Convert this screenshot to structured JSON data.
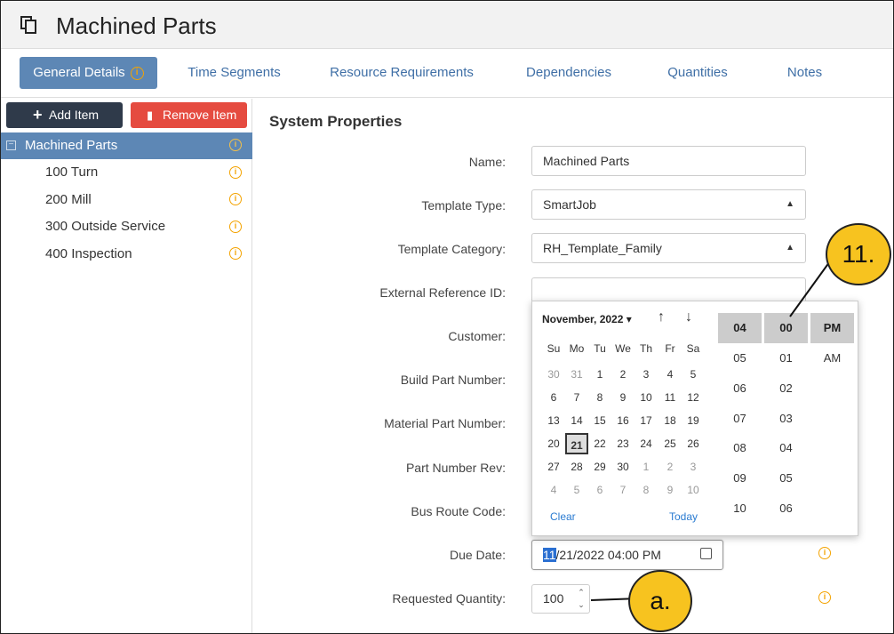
{
  "window": {
    "title": "Machined Parts"
  },
  "tabs": [
    {
      "label": "General Details"
    },
    {
      "label": "Time Segments"
    },
    {
      "label": "Resource Requirements"
    },
    {
      "label": "Dependencies"
    },
    {
      "label": "Quantities"
    },
    {
      "label": "Notes"
    }
  ],
  "toolbar": {
    "add_label": "Add Item",
    "remove_label": "Remove Item"
  },
  "tree": {
    "root": "Machined Parts",
    "items": [
      "100 Turn",
      "200 Mill",
      "300 Outside Service",
      "400 Inspection"
    ]
  },
  "form": {
    "section_title": "System Properties",
    "name_label": "Name:",
    "name_value": "Machined Parts",
    "template_type_label": "Template Type:",
    "template_type_value": "SmartJob",
    "template_category_label": "Template Category:",
    "template_category_value": "RH_Template_Family",
    "external_ref_label": "External Reference ID:",
    "customer_label": "Customer:",
    "build_part_label": "Build Part Number:",
    "material_part_label": "Material Part Number:",
    "part_rev_label": "Part Number Rev:",
    "bus_route_label": "Bus Route Code:",
    "due_date_label": "Due Date:",
    "due_date_selected": "11",
    "due_date_rest": "/21/2022 04:00 PM",
    "requested_qty_label": "Requested Quantity:",
    "requested_qty_value": "100"
  },
  "picker": {
    "month": "November, 2022 ▾",
    "dow": [
      "Su",
      "Mo",
      "Tu",
      "We",
      "Th",
      "Fr",
      "Sa"
    ],
    "weeks": [
      [
        "30",
        "31",
        "1",
        "2",
        "3",
        "4",
        "5"
      ],
      [
        "6",
        "7",
        "8",
        "9",
        "10",
        "11",
        "12"
      ],
      [
        "13",
        "14",
        "15",
        "16",
        "17",
        "18",
        "19"
      ],
      [
        "20",
        "21",
        "22",
        "23",
        "24",
        "25",
        "26"
      ],
      [
        "27",
        "28",
        "29",
        "30",
        "1",
        "2",
        "3"
      ],
      [
        "4",
        "5",
        "6",
        "7",
        "8",
        "9",
        "10"
      ]
    ],
    "clear_label": "Clear",
    "today_label": "Today",
    "hour_selected": "04",
    "hours": [
      "05",
      "06",
      "07",
      "08",
      "09",
      "10"
    ],
    "minute_selected": "00",
    "minutes": [
      "01",
      "02",
      "03",
      "04",
      "05",
      "06"
    ],
    "ampm_selected": "PM",
    "ampm_other": "AM"
  },
  "callouts": {
    "c1": "11.",
    "c2": "a."
  },
  "colors": {
    "accent": "#5d87b5",
    "danger": "#e54b40",
    "dark": "#2f3a4a",
    "info": "#f4a300",
    "callout": "#f7c31f"
  }
}
